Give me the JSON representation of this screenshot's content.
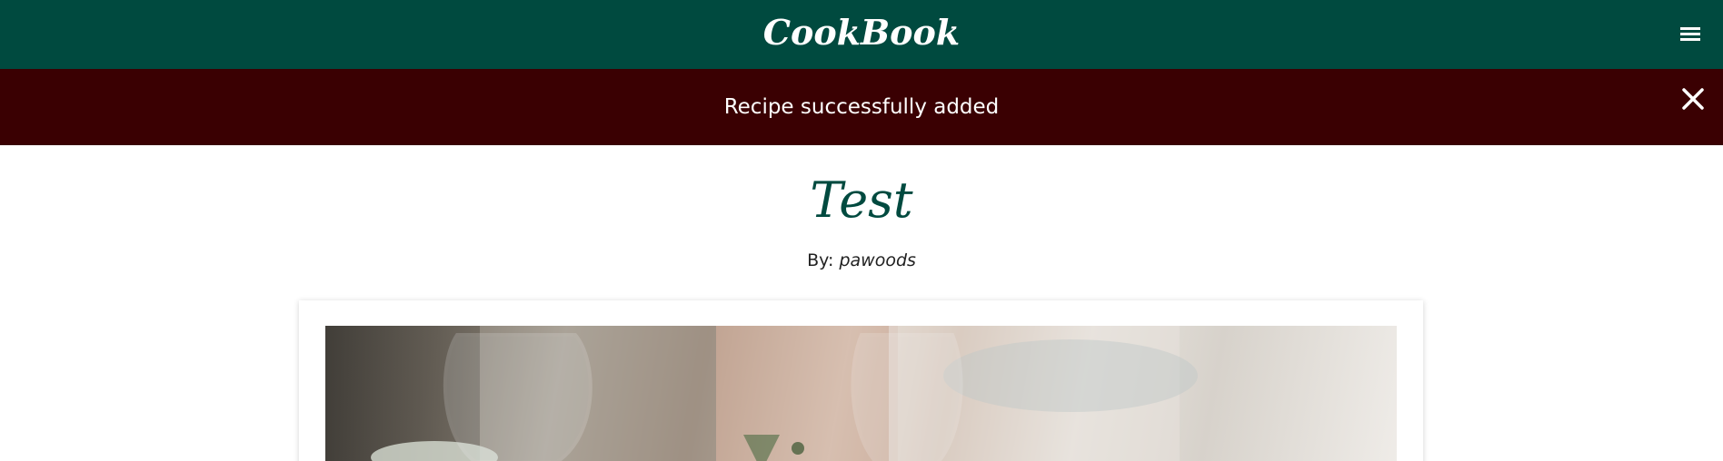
{
  "navbar": {
    "brand": "CookBook",
    "menu_icon": "hamburger-menu-icon",
    "background_color": "#004a3f"
  },
  "flash": {
    "message": "Recipe successfully added",
    "close_icon": "close-icon",
    "background_color": "#3a0002"
  },
  "recipe": {
    "title": "Test",
    "by_label": "By:",
    "author": "pawoods",
    "title_color": "#004a3f"
  },
  "image": {
    "description_icon": "recipe-photo"
  }
}
